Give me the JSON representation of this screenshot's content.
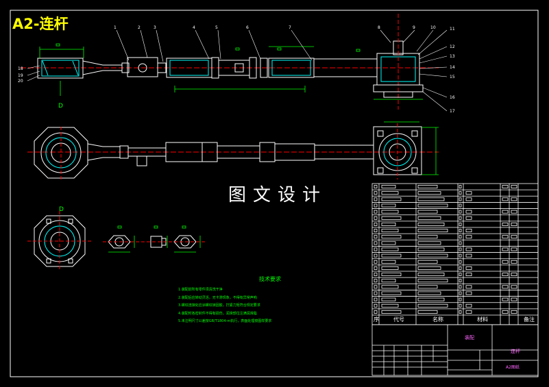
{
  "drawing": {
    "sheet_title": "A2-连杆",
    "watermark": "图文设计",
    "view_label_top": "D",
    "view_label_section": "D",
    "part_numbers": [
      "1",
      "2",
      "3",
      "4",
      "5",
      "6",
      "7",
      "8",
      "9",
      "10",
      "11",
      "12",
      "13",
      "14",
      "15",
      "16",
      "17"
    ],
    "left_numbers": [
      "18",
      "19",
      "20"
    ]
  },
  "tech_requirements": {
    "title": "技术要求",
    "lines": [
      "1.装配前所有零件须清洗干净",
      "2.装配后应转动灵活，无卡滞现象，不得有异常声响",
      "3.螺纹连接处应涂螺纹锁固胶，拧紧力矩符合规定要求",
      "4.装配时各密封件不得有损伤，润滑部位注满润滑脂",
      "5.未注明尺寸公差按GB/T1804-m执行，表面处理按图样要求"
    ]
  },
  "title_block": {
    "col_seq": "序",
    "col_code": "代号",
    "col_name": "名称",
    "col_material": "材料",
    "col_remark": "备注",
    "assembly_name": "连杆",
    "drawing_label": "装配",
    "footer_code": "A2图纸"
  },
  "colors": {
    "outline": "#ffffff",
    "section": "#00ffff",
    "centerline": "#ff0000",
    "dimension": "#00ff00",
    "title": "#ffff00"
  }
}
